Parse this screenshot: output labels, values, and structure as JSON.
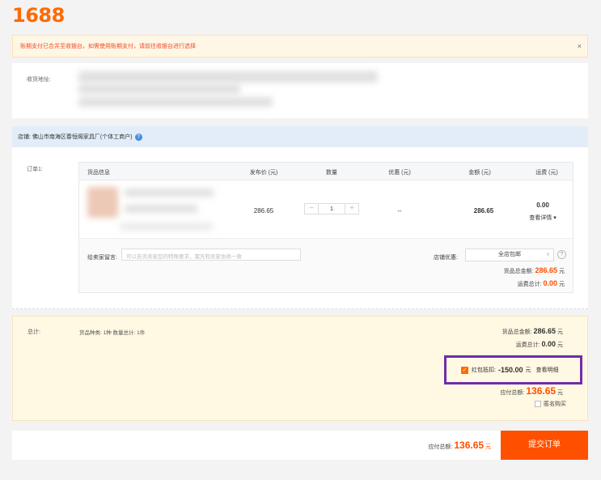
{
  "logo": "1688",
  "notice": {
    "text": "账期支付已合并至收银台，如需使用账期支付，请前往收银台进行选择",
    "close": "×"
  },
  "address": {
    "label": "收货地址:"
  },
  "shop": {
    "label": "店铺: 佛山市南海区春恒阁家具厂(个体工商户)",
    "help_icon": "?"
  },
  "order": {
    "label": "订单1:",
    "columns": [
      "货品信息",
      "发布价 (元)",
      "数量",
      "优惠 (元)",
      "金额 (元)",
      "运费 (元)"
    ],
    "row": {
      "price": "286.65",
      "quantity": "1",
      "discount": "--",
      "amount": "286.65",
      "shipping": "0.00",
      "shipping_detail": "查看详情 ▾",
      "minus": "−",
      "plus": "+"
    },
    "message_label": "给卖家留言:",
    "message_placeholder": "可以告诉卖家您的特殊要求，需先和卖家协商一致",
    "discount_label": "店铺优惠:",
    "discount_value": "全店包邮",
    "discount_chevron": "∨",
    "help": "?",
    "goods_total_label": "货品总金额:",
    "goods_total": "286.65",
    "ship_total_label": "运费总计:",
    "ship_total": "0.00",
    "unit": "元"
  },
  "summary": {
    "label": "总计:",
    "meta": "货品种类: 1种  数量总计: 1件",
    "goods_total_label": "货品总金额:",
    "goods_total": "286.65",
    "ship_label": "运费总计:",
    "ship_total": "0.00",
    "coupon_label": "红包抵扣:",
    "coupon_value": "-150.00",
    "coupon_detail": "查看明细",
    "check": "✓",
    "payable_label": "应付总额:",
    "payable": "136.65",
    "anonymous": "匿名购买",
    "unit": "元"
  },
  "bottom": {
    "payable_label": "应付总额:",
    "payable": "136.65",
    "unit": "元",
    "submit": "提交订单"
  },
  "colors": {
    "brand": "#ff6a00",
    "price": "#ff5000",
    "highlight": "#6f2da8"
  }
}
